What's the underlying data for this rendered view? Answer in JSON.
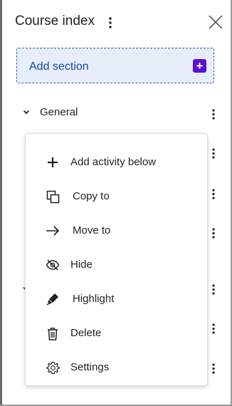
{
  "header": {
    "title": "Course index"
  },
  "add_section": {
    "label": "Add section",
    "icon": "plus-icon"
  },
  "sections": [
    {
      "label": "General",
      "icon": "chevron-down-icon"
    }
  ],
  "menu": {
    "items": [
      {
        "label": "Add activity below",
        "icon": "plus-icon"
      },
      {
        "label": "Copy to",
        "icon": "copy-icon"
      },
      {
        "label": "Move to",
        "icon": "arrow-right-icon"
      },
      {
        "label": "Hide",
        "icon": "eye-slash-icon"
      },
      {
        "label": "Highlight",
        "icon": "marker-icon"
      },
      {
        "label": "Delete",
        "icon": "trash-icon"
      },
      {
        "label": "Settings",
        "icon": "gear-icon"
      }
    ]
  },
  "colors": {
    "accent": "#5b0fd1",
    "link": "#0f47ad",
    "add_section_bg": "#e7eef9",
    "text": "#1d2125"
  }
}
